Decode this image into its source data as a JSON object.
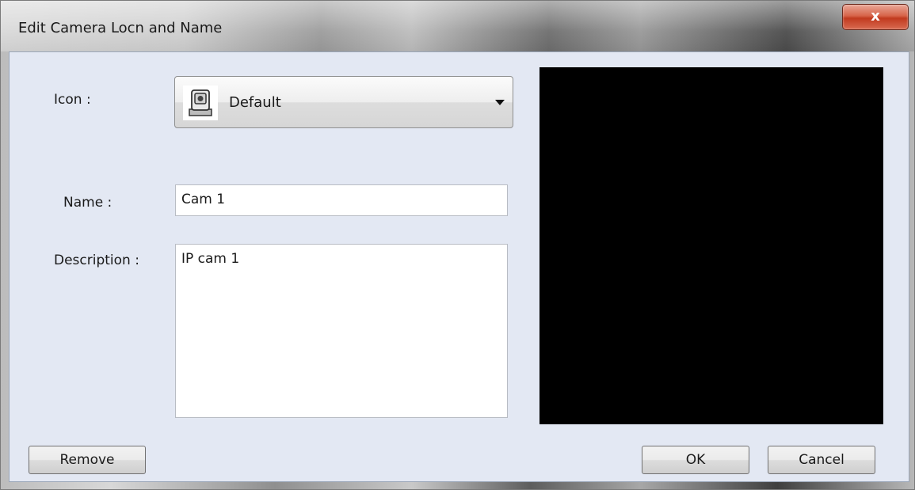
{
  "window": {
    "title": "Edit Camera Locn and Name",
    "close_glyph": "x"
  },
  "form": {
    "icon_label": "Icon :",
    "icon_value": "Default",
    "icon_name": "camera-icon",
    "name_label": "Name :",
    "name_value": "Cam 1",
    "description_label": "Description :",
    "description_value": "IP cam 1"
  },
  "buttons": {
    "remove": "Remove",
    "ok": "OK",
    "cancel": "Cancel"
  },
  "colors": {
    "dialog_bg": "#e3e8f3",
    "preview_bg": "#000000",
    "close_button": "#c13a1f"
  }
}
